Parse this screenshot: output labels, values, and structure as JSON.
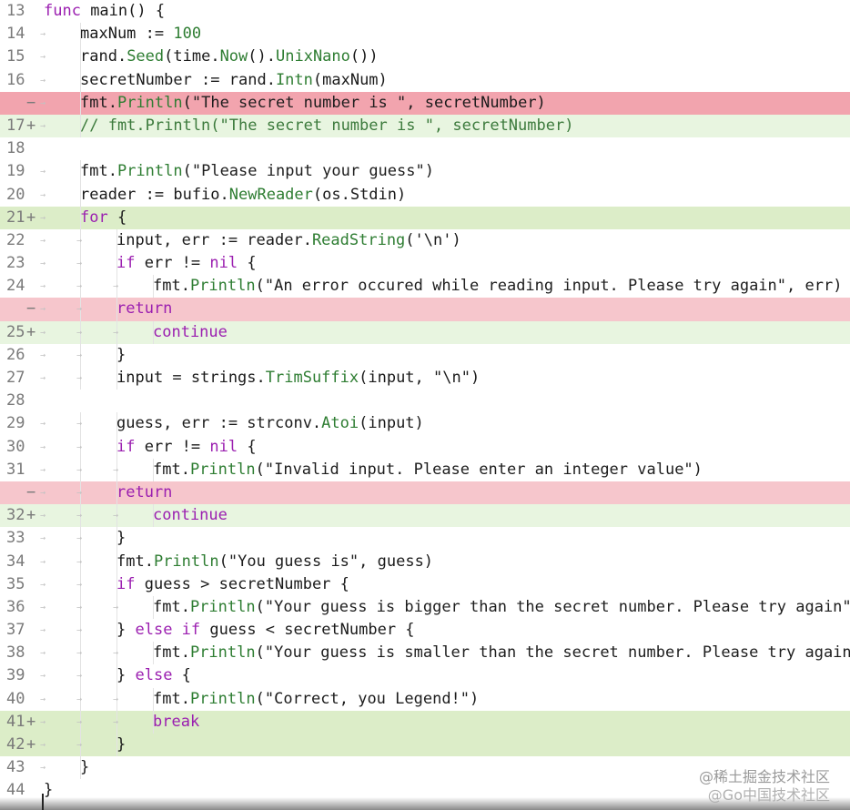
{
  "editor": {
    "lines": [
      {
        "num": "13",
        "marker": "",
        "type": "normal",
        "indent": 0,
        "html": "<span class='kw'>func</span> main() {"
      },
      {
        "num": "14",
        "marker": "",
        "type": "normal",
        "indent": 1,
        "html": "maxNum := <span class='num'>100</span>"
      },
      {
        "num": "15",
        "marker": "",
        "type": "normal",
        "indent": 1,
        "html": "rand.<span class='fn'>Seed</span>(time.<span class='fn'>Now</span>().<span class='fn'>UnixNano</span>())"
      },
      {
        "num": "16",
        "marker": "",
        "type": "normal",
        "indent": 1,
        "html": "secretNumber := rand.<span class='fn'>Intn</span>(maxNum)"
      },
      {
        "num": "",
        "marker": "−",
        "type": "removed strong",
        "indent": 1,
        "html": "fmt.<span class='fn'>Println</span>(<span class='str'>\"The secret number is \"</span>, secretNumber)"
      },
      {
        "num": "17",
        "marker": "+",
        "type": "added",
        "indent": 1,
        "html": "<span class='cm'>// fmt.Println(\"The secret number is \", secretNumber)</span>"
      },
      {
        "num": "18",
        "marker": "",
        "type": "normal",
        "indent": 0,
        "html": ""
      },
      {
        "num": "19",
        "marker": "",
        "type": "normal",
        "indent": 1,
        "html": "fmt.<span class='fn'>Println</span>(<span class='str'>\"Please input your guess\"</span>)"
      },
      {
        "num": "20",
        "marker": "",
        "type": "normal",
        "indent": 1,
        "html": "reader := bufio.<span class='fn'>NewReader</span>(os.Stdin)"
      },
      {
        "num": "21",
        "marker": "+",
        "type": "added strong",
        "indent": 1,
        "html": "<span class='kw'>for</span> {"
      },
      {
        "num": "22",
        "marker": "",
        "type": "normal",
        "indent": 2,
        "html": "input, err := reader.<span class='fn'>ReadString</span>(<span class='str'>'\\n'</span>)"
      },
      {
        "num": "23",
        "marker": "",
        "type": "normal",
        "indent": 2,
        "html": "<span class='kw'>if</span> err != <span class='kw'>nil</span> {"
      },
      {
        "num": "24",
        "marker": "",
        "type": "normal",
        "indent": 3,
        "html": "fmt.<span class='fn'>Println</span>(<span class='str'>\"An error occured while reading input. Please try again\"</span>, err)"
      },
      {
        "num": "",
        "marker": "−",
        "type": "removed",
        "indent": 2,
        "html": "<span class='kw'>return</span>"
      },
      {
        "num": "25",
        "marker": "+",
        "type": "added",
        "indent": 3,
        "html": "<span class='kw'>continue</span>"
      },
      {
        "num": "26",
        "marker": "",
        "type": "normal",
        "indent": 2,
        "html": "}"
      },
      {
        "num": "27",
        "marker": "",
        "type": "normal",
        "indent": 2,
        "html": "input = strings.<span class='fn'>TrimSuffix</span>(input, <span class='str'>\"\\n\"</span>)"
      },
      {
        "num": "28",
        "marker": "",
        "type": "normal",
        "indent": 0,
        "html": ""
      },
      {
        "num": "29",
        "marker": "",
        "type": "normal",
        "indent": 2,
        "html": "guess, err := strconv.<span class='fn'>Atoi</span>(input)"
      },
      {
        "num": "30",
        "marker": "",
        "type": "normal",
        "indent": 2,
        "html": "<span class='kw'>if</span> err != <span class='kw'>nil</span> {"
      },
      {
        "num": "31",
        "marker": "",
        "type": "normal",
        "indent": 3,
        "html": "fmt.<span class='fn'>Println</span>(<span class='str'>\"Invalid input. Please enter an integer value\"</span>)"
      },
      {
        "num": "",
        "marker": "−",
        "type": "removed",
        "indent": 2,
        "html": "<span class='kw'>return</span>"
      },
      {
        "num": "32",
        "marker": "+",
        "type": "added",
        "indent": 3,
        "html": "<span class='kw'>continue</span>"
      },
      {
        "num": "33",
        "marker": "",
        "type": "normal",
        "indent": 2,
        "html": "}"
      },
      {
        "num": "34",
        "marker": "",
        "type": "normal",
        "indent": 2,
        "html": "fmt.<span class='fn'>Println</span>(<span class='str'>\"You guess is\"</span>, guess)"
      },
      {
        "num": "35",
        "marker": "",
        "type": "normal",
        "indent": 2,
        "html": "<span class='kw'>if</span> guess > secretNumber {"
      },
      {
        "num": "36",
        "marker": "",
        "type": "normal",
        "indent": 3,
        "html": "fmt.<span class='fn'>Println</span>(<span class='str'>\"Your guess is bigger than the secret number. Please try again\"</span>)"
      },
      {
        "num": "37",
        "marker": "",
        "type": "normal",
        "indent": 2,
        "html": "} <span class='kw'>else if</span> guess < secretNumber {"
      },
      {
        "num": "38",
        "marker": "",
        "type": "normal",
        "indent": 3,
        "html": "fmt.<span class='fn'>Println</span>(<span class='str'>\"Your guess is smaller than the secret number. Please try again\"</span>)"
      },
      {
        "num": "39",
        "marker": "",
        "type": "normal",
        "indent": 2,
        "html": "} <span class='kw'>else</span> {"
      },
      {
        "num": "40",
        "marker": "",
        "type": "normal",
        "indent": 3,
        "html": "fmt.<span class='fn'>Println</span>(<span class='str'>\"Correct, you Legend!\"</span>)"
      },
      {
        "num": "41",
        "marker": "+",
        "type": "added strong",
        "indent": 3,
        "html": "<span class='kw'>break</span>"
      },
      {
        "num": "42",
        "marker": "+",
        "type": "added strong",
        "indent": 2,
        "html": "}"
      },
      {
        "num": "43",
        "marker": "",
        "type": "normal",
        "indent": 1,
        "html": "}"
      },
      {
        "num": "44",
        "marker": "",
        "type": "normal",
        "indent": 0,
        "html": "}"
      }
    ]
  },
  "watermark": {
    "line1": "@稀土掘金技术社区",
    "line2": "@Go中国技术社区"
  }
}
